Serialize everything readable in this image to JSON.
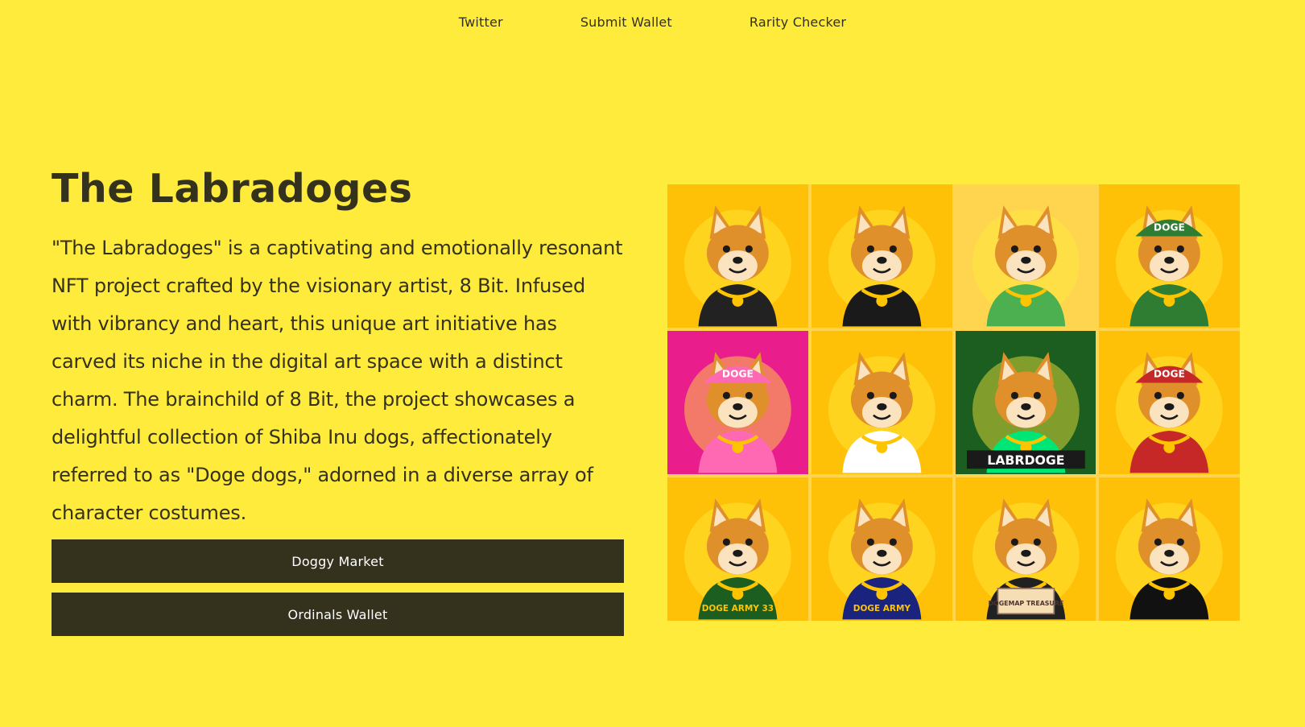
{
  "nav": {
    "items": [
      "Twitter",
      "Submit Wallet",
      "Rarity Checker"
    ]
  },
  "hero": {
    "title": "The Labradoges",
    "description": "\"The Labradoges\" is a captivating and emotionally resonant NFT project crafted by the visionary artist, 8 Bit. Infused with vibrancy and heart, this unique art initiative has carved its niche in the digital art space with a distinct charm. The brainchild of 8 Bit, the project showcases a delightful collection of Shiba Inu dogs, affectionately referred to as \"Doge dogs,\" adorned in a diverse array of character costumes.",
    "buttons": [
      "Doggy Market",
      "Ordinals Wallet"
    ]
  },
  "gallery": {
    "tiles": [
      {
        "icon": "doge-balaclava-suit-icon",
        "bg": "#ffc107",
        "accent": "#222222"
      },
      {
        "icon": "doge-punk-mohawk-icon",
        "bg": "#ffc107",
        "accent": "#1a1a1a"
      },
      {
        "icon": "doge-scientist-pipe-icon",
        "bg": "#ffd54f",
        "accent": "#4caf50"
      },
      {
        "icon": "doge-hoodie-cap-icon",
        "bg": "#ffc107",
        "accent": "#2e7d32",
        "cap_text": "DOGE"
      },
      {
        "icon": "doge-pink-jacket-icon",
        "bg": "#e91e8c",
        "accent": "#ff69b4",
        "cap_text": "DOGE"
      },
      {
        "icon": "doge-astronaut-icon",
        "bg": "#ffc107",
        "accent": "#ffffff"
      },
      {
        "icon": "doge-matrix-warrior-icon",
        "bg": "#1b5e20",
        "accent": "#00e676",
        "label_text": "LABRDOGE"
      },
      {
        "icon": "doge-fur-jacket-cap-icon",
        "bg": "#ffc107",
        "accent": "#c62828",
        "cap_text": "DOGE"
      },
      {
        "icon": "doge-basketball-green-icon",
        "bg": "#ffc107",
        "accent": "#1b5e20",
        "jersey_text": "DOGE ARMY 33"
      },
      {
        "icon": "doge-basketball-navy-icon",
        "bg": "#ffc107",
        "accent": "#1a237e",
        "jersey_text": "DOGE ARMY"
      },
      {
        "icon": "doge-pirate-map-icon",
        "bg": "#ffc107",
        "accent": "#212121",
        "map_text": "DOGEMAP TREASURE"
      },
      {
        "icon": "doge-dark-knight-icon",
        "bg": "#ffc107",
        "accent": "#111111"
      }
    ]
  }
}
